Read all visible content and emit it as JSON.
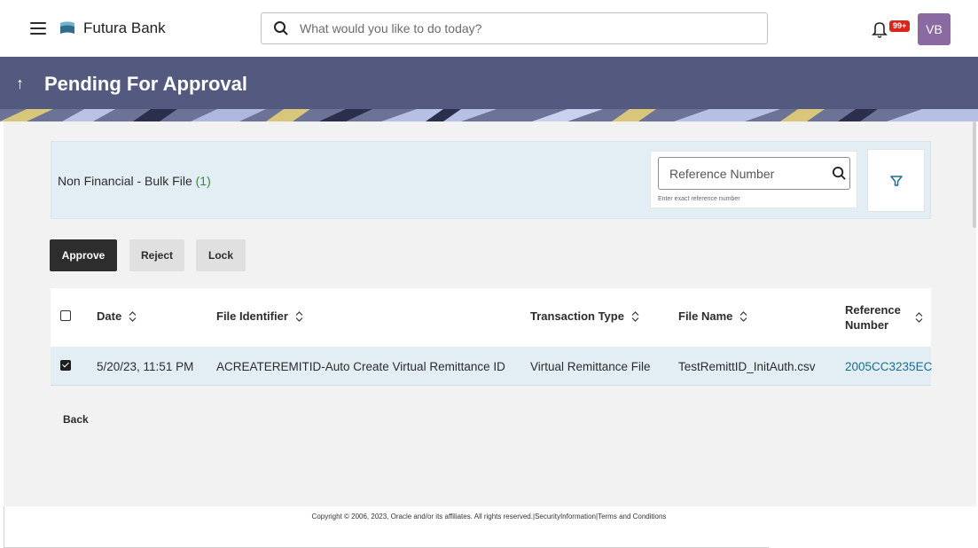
{
  "header": {
    "brand_name": "Futura Bank",
    "search_placeholder": "What would you like to do today?",
    "notification_badge": "99+",
    "avatar_initials": "VB"
  },
  "page": {
    "back_arrow": "↑",
    "title": "Pending For Approval"
  },
  "summary": {
    "label": "Non Financial - Bulk File",
    "count": "(1)",
    "ref_placeholder": "Reference Number",
    "ref_hint": "Enter exact reference number"
  },
  "actions": {
    "approve": "Approve",
    "reject": "Reject",
    "lock": "Lock"
  },
  "table": {
    "columns": {
      "date": "Date",
      "file_identifier": "File Identifier",
      "transaction_type": "Transaction Type",
      "file_name": "File Name",
      "reference_number_1": "Reference",
      "reference_number_2": "Number"
    },
    "rows": [
      {
        "checked": true,
        "date": "5/20/23, 11:51 PM",
        "file_identifier": "ACREATEREMITID-Auto Create Virtual Remittance ID",
        "transaction_type": "Virtual Remittance File",
        "file_name": "TestRemittID_InitAuth.csv",
        "reference_number": "2005CC3235EC"
      }
    ]
  },
  "back_label": "Back",
  "footer": {
    "copyright": "Copyright © 2006, 2023, Oracle and/or its affiliates. All rights reserved.",
    "security": "|SecurityInformation|",
    "terms": "Terms and Conditions"
  },
  "colors": {
    "banner": "#545a7f",
    "summary_bg": "#e2eef4",
    "link": "#1b6d8f",
    "avatar": "#8a6aa0",
    "badge": "#d9261c"
  }
}
